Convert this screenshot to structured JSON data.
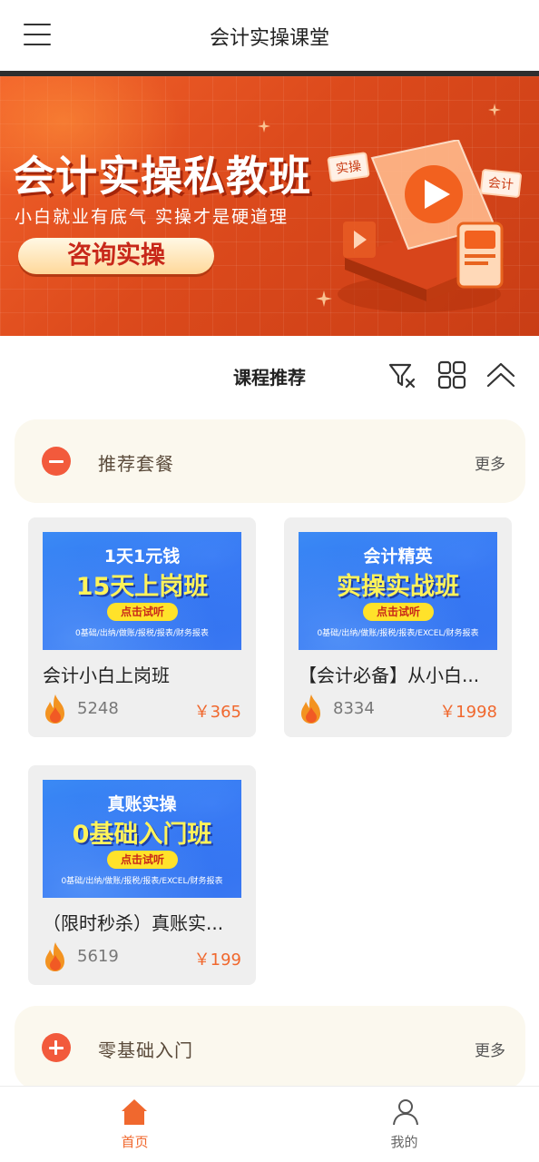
{
  "header": {
    "title": "会计实操课堂",
    "menu_icon": "hamburger-menu-icon"
  },
  "banner": {
    "title": "会计实操私教班",
    "subtitle": "小白就业有底气  实操才是硬道理",
    "cta_label": "咨询实操",
    "tag_left": "实操",
    "tag_right": "会计",
    "colors": {
      "primary": "#dc4a1c",
      "cta_text": "#c8281a"
    }
  },
  "section": {
    "title": "课程推荐",
    "icons": [
      "filter-clear-icon",
      "grid-view-icon",
      "collapse-up-icon"
    ]
  },
  "categories": [
    {
      "name": "推荐套餐",
      "more": "更多",
      "state": "expanded"
    },
    {
      "name": "零基础入门",
      "more": "更多",
      "state": "collapsed"
    }
  ],
  "courses": [
    {
      "thumb_line1": "1天1元钱",
      "thumb_line2": "15天上岗班",
      "thumb_button": "点击试听",
      "thumb_footer": "0基础/出纳/做账/报税/报表/财务报表",
      "name": "会计小白上岗班",
      "count": "5248",
      "price": "￥365"
    },
    {
      "thumb_line1": "会计精英",
      "thumb_line2": "实操实战班",
      "thumb_button": "点击试听",
      "thumb_footer": "0基础/出纳/做账/报税/报表/EXCEL/财务报表",
      "name": "【会计必备】从小白...",
      "count": "8334",
      "price": "￥1998"
    },
    {
      "thumb_line1": "真账实操",
      "thumb_line2": "0基础入门班",
      "thumb_button": "点击试听",
      "thumb_footer": "0基础/出纳/做账/报税/报表/EXCEL/财务报表",
      "name": "（限时秒杀）真账实...",
      "count": "5619",
      "price": "￥199"
    }
  ],
  "bottom_nav": [
    {
      "label": "首页",
      "icon": "home-icon",
      "active": true
    },
    {
      "label": "我的",
      "icon": "user-icon",
      "active": false
    }
  ],
  "colors": {
    "accent": "#f0682e",
    "active_nav": "#f0682e",
    "inactive_nav": "#666666",
    "card_bg": "#efefef",
    "category_bg": "#fbf8ee"
  }
}
